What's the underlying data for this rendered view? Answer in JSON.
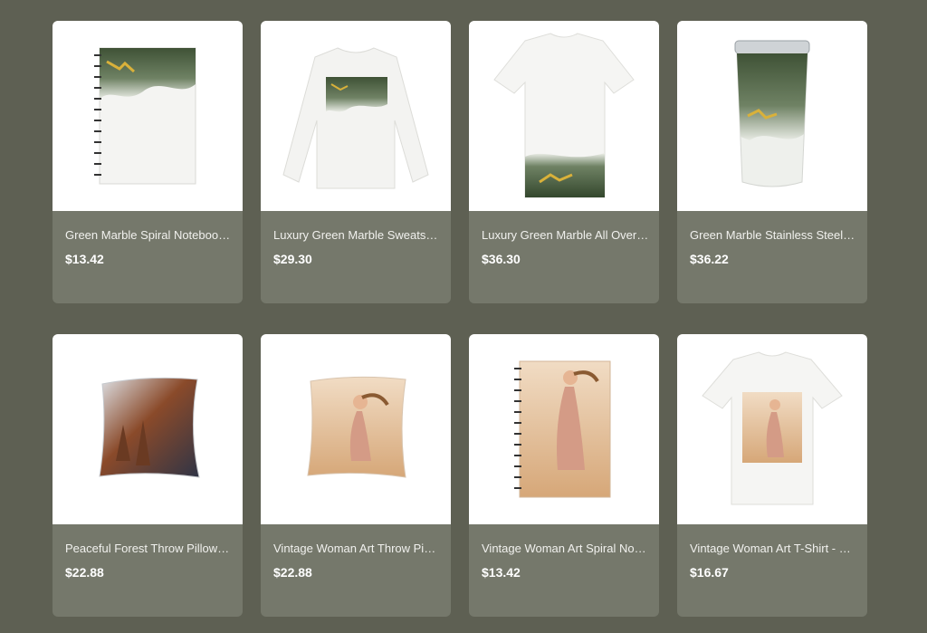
{
  "colors": {
    "page_background": "#5e6053",
    "card_info_background": "#75786b",
    "thumbnail_background": "#ffffff"
  },
  "products": [
    {
      "title": "Green Marble Spiral Noteboo…",
      "price": "$13.42",
      "image": "green-marble-spiral-notebook"
    },
    {
      "title": "Luxury Green Marble Sweats…",
      "price": "$29.30",
      "image": "green-marble-sweatshirt"
    },
    {
      "title": "Luxury Green Marble All Over…",
      "price": "$36.30",
      "image": "green-marble-all-over-tshirt"
    },
    {
      "title": "Green Marble Stainless Steel…",
      "price": "$36.22",
      "image": "green-marble-tumbler"
    },
    {
      "title": "Peaceful Forest Throw Pillow…",
      "price": "$22.88",
      "image": "forest-throw-pillow"
    },
    {
      "title": "Vintage Woman Art Throw Pi…",
      "price": "$22.88",
      "image": "vintage-woman-throw-pillow"
    },
    {
      "title": "Vintage Woman Art Spiral No…",
      "price": "$13.42",
      "image": "vintage-woman-spiral-notebook"
    },
    {
      "title": "Vintage Woman Art T-Shirt - …",
      "price": "$16.67",
      "image": "vintage-woman-tshirt"
    }
  ]
}
